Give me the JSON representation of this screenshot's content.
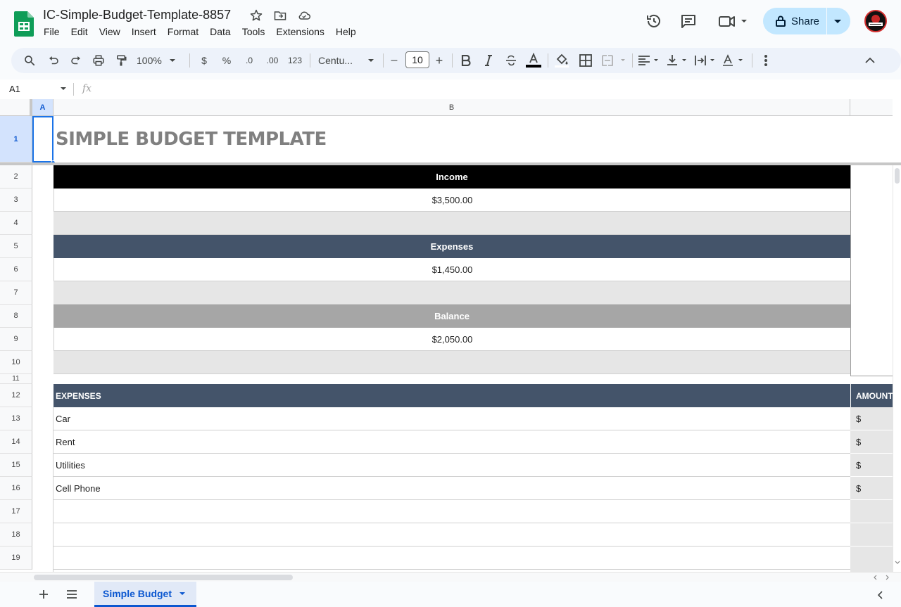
{
  "doc": {
    "title": "IC-Simple-Budget-Template-8857"
  },
  "menu": [
    "File",
    "Edit",
    "View",
    "Insert",
    "Format",
    "Data",
    "Tools",
    "Extensions",
    "Help"
  ],
  "share": {
    "label": "Share"
  },
  "toolbar": {
    "zoom": "100%",
    "currency": "$",
    "percent": "%",
    "dec_decrease": ".0",
    "dec_increase": ".00",
    "number_format": "123",
    "font": "Centu...",
    "font_size": "10",
    "minus": "–",
    "plus": "+"
  },
  "formula_bar": {
    "cell_ref": "A1",
    "fx": "fx"
  },
  "columns": [
    "A",
    "B"
  ],
  "rows": [
    "1",
    "2",
    "3",
    "4",
    "5",
    "6",
    "7",
    "8",
    "9",
    "10",
    "11",
    "12",
    "13",
    "14",
    "15",
    "16",
    "17",
    "18",
    "19"
  ],
  "sheet": {
    "title": "SIMPLE BUDGET TEMPLATE",
    "summary": {
      "income_label": "Income",
      "income_value": "$3,500.00",
      "expenses_label": "Expenses",
      "expenses_value": "$1,450.00",
      "balance_label": "Balance",
      "balance_value": "$2,050.00"
    },
    "table": {
      "header_expenses": "EXPENSES",
      "header_amount": "AMOUNT",
      "rows": [
        {
          "name": "Car",
          "amount": "$"
        },
        {
          "name": "Rent",
          "amount": "$"
        },
        {
          "name": "Utilities",
          "amount": "$"
        },
        {
          "name": "Cell Phone",
          "amount": "$"
        }
      ]
    }
  },
  "tabs": {
    "active": "Simple Budget"
  },
  "colors": {
    "income_header": "#000000",
    "expenses_header": "#44546a",
    "balance_header": "#a6a6a6",
    "band": "#e6e6e6",
    "accent": "#0b57d0"
  }
}
